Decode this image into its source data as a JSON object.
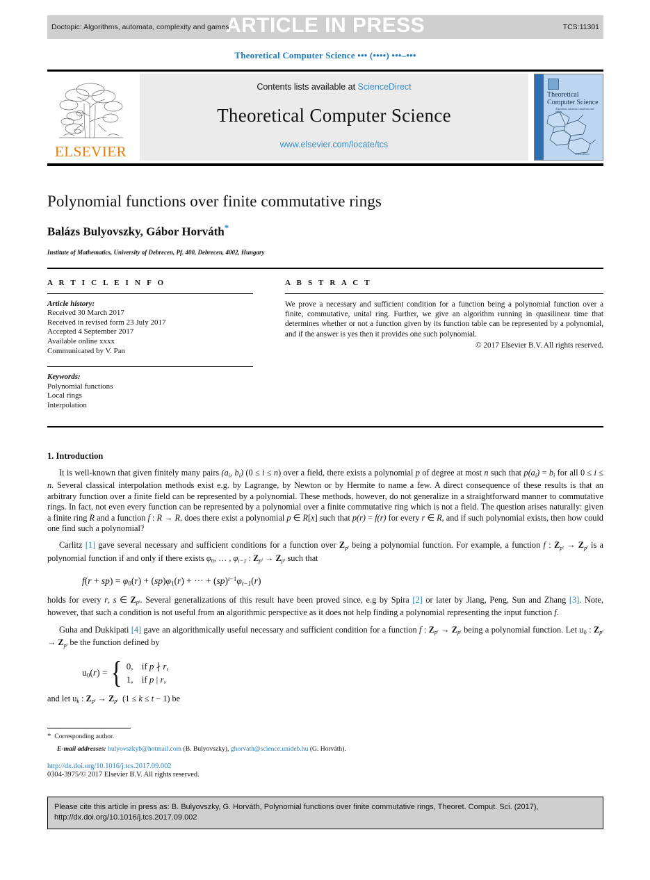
{
  "running_head": {
    "doctopic": "Doctopic: Algorithms, automata, complexity and games",
    "stamp": "ARTICLE IN PRESS",
    "code": "TCS:11301"
  },
  "journal_ref": "Theoretical Computer Science ••• (••••) •••–•••",
  "masthead": {
    "publisher": "ELSEVIER",
    "contents_prefix": "Contents lists available at ",
    "contents_link": "ScienceDirect",
    "journal_title": "Theoretical Computer Science",
    "journal_url": "www.elsevier.com/locate/tcs",
    "cover_title": "Theoretical Computer Science",
    "cover_subtitle": "Algorithms, automata, complexity and games",
    "cover_footer": "ScienceDirect",
    "link_color": "#3a8fc4",
    "accent_color": "#f07c00"
  },
  "article": {
    "title": "Polynomial functions over finite commutative rings",
    "authors": "Balázs Bulyovszky, Gábor Horváth",
    "corresponding_marker": "*",
    "affiliation": "Institute of Mathematics, University of Debrecen, Pf. 400, Debrecen, 4002, Hungary"
  },
  "info": {
    "heading": "A R T I C L E   I N F O",
    "history_label": "Article history:",
    "history": [
      "Received 30 March 2017",
      "Received in revised form 23 July 2017",
      "Accepted 4 September 2017",
      "Available online xxxx",
      "Communicated by V. Pan"
    ],
    "keywords_label": "Keywords:",
    "keywords": [
      "Polynomial functions",
      "Local rings",
      "Interpolation"
    ]
  },
  "abstract": {
    "heading": "A B S T R A C T",
    "text": "We prove a necessary and sufficient condition for a function being a polynomial function over a finite, commutative, unital ring. Further, we give an algorithm running in quasilinear time that determines whether or not a function given by its function table can be represented by a polynomial, and if the answer is yes then it provides one such polynomial.",
    "copyright": "© 2017 Elsevier B.V. All rights reserved."
  },
  "body": {
    "section_title": "1. Introduction",
    "para1_a": "It is well-known that given finitely many pairs (a",
    "para1": "It is well-known that given finitely many pairs (a_i, b_i) (0 ≤ i ≤ n) over a field, there exists a polynomial p of degree at most n such that p(a_i) = b_i for all 0 ≤ i ≤ n. Several classical interpolation methods exist e.g. by Lagrange, by Newton or by Hermite to name a few. A direct consequence of these results is that an arbitrary function over a finite field can be represented by a polynomial. These methods, however, do not generalize in a straightforward manner to commutative rings. In fact, not even every function can be represented by a polynomial over a finite commutative ring which is not a field. The question arises naturally: given a finite ring R and a function f: R → R, does there exist a polynomial p ∈ R[x] such that p(r) = f(r) for every r ∈ R, and if such polynomial exists, then how could one find such a polynomial?",
    "para2": "Carlitz [1] gave several necessary and sufficient conditions for a function over Z_{p^t} being a polynomial function. For example, a function f: Z_{p^t} → Z_{p^t} is a polynomial function if and only if there exists φ_0, …, φ_{t−1}: Z_{p^t} → Z_{p^t} such that",
    "equation1": "f(r + sp) = φ0(r) + (sp)φ1(r) + ⋯ + (sp)^{t−1}φ_{t−1}(r)",
    "para3": "holds for every r, s ∈ Z_{p^t}. Several generalizations of this result have been proved since, e.g by Spira [2] or later by Jiang, Peng, Sun and Zhang [3]. Note, however, that such a condition is not useful from an algorithmic perspective as it does not help finding a polynomial representing the input function f.",
    "para4": "Guha and Dukkipati [4] gave an algorithmically useful necessary and sufficient condition for a function f: Z_{p^t} → Z_{p^t} being a polynomial function. Let u_0: Z_{p^t} → Z_{p^t} be the function defined by",
    "equation2_lhs": "u0(r) =",
    "equation2_case1_value": "0,",
    "equation2_case1_cond": "if p ∤ r,",
    "equation2_case2_value": "1,",
    "equation2_case2_cond": "if p | r,",
    "para5": "and let u_k: Z_{p^t} → Z_{p^t} (1 ≤ k ≤ t − 1) be",
    "citations": [
      "1",
      "2",
      "3",
      "4"
    ],
    "citation_color": "#1f7bbf"
  },
  "footnote": {
    "star": "*",
    "corresponding": "Corresponding author.",
    "email_label": "E-mail addresses:",
    "email1": "bulyovszkyb@hotmail.com",
    "email1_name": "(B. Bulyovszky),",
    "email2": "ghorvath@science.unideb.hu",
    "email2_name": "(G. Horváth).",
    "doi": "http://dx.doi.org/10.1016/j.tcs.2017.09.002",
    "issn_line": "0304-3975/© 2017 Elsevier B.V. All rights reserved."
  },
  "cite_box": {
    "line1": "Please cite this article in press as: B. Bulyovszky, G. Horváth, Polynomial functions over finite commutative rings, Theoret. Comput. Sci. (2017),",
    "line2": "http://dx.doi.org/10.1016/j.tcs.2017.09.002"
  }
}
